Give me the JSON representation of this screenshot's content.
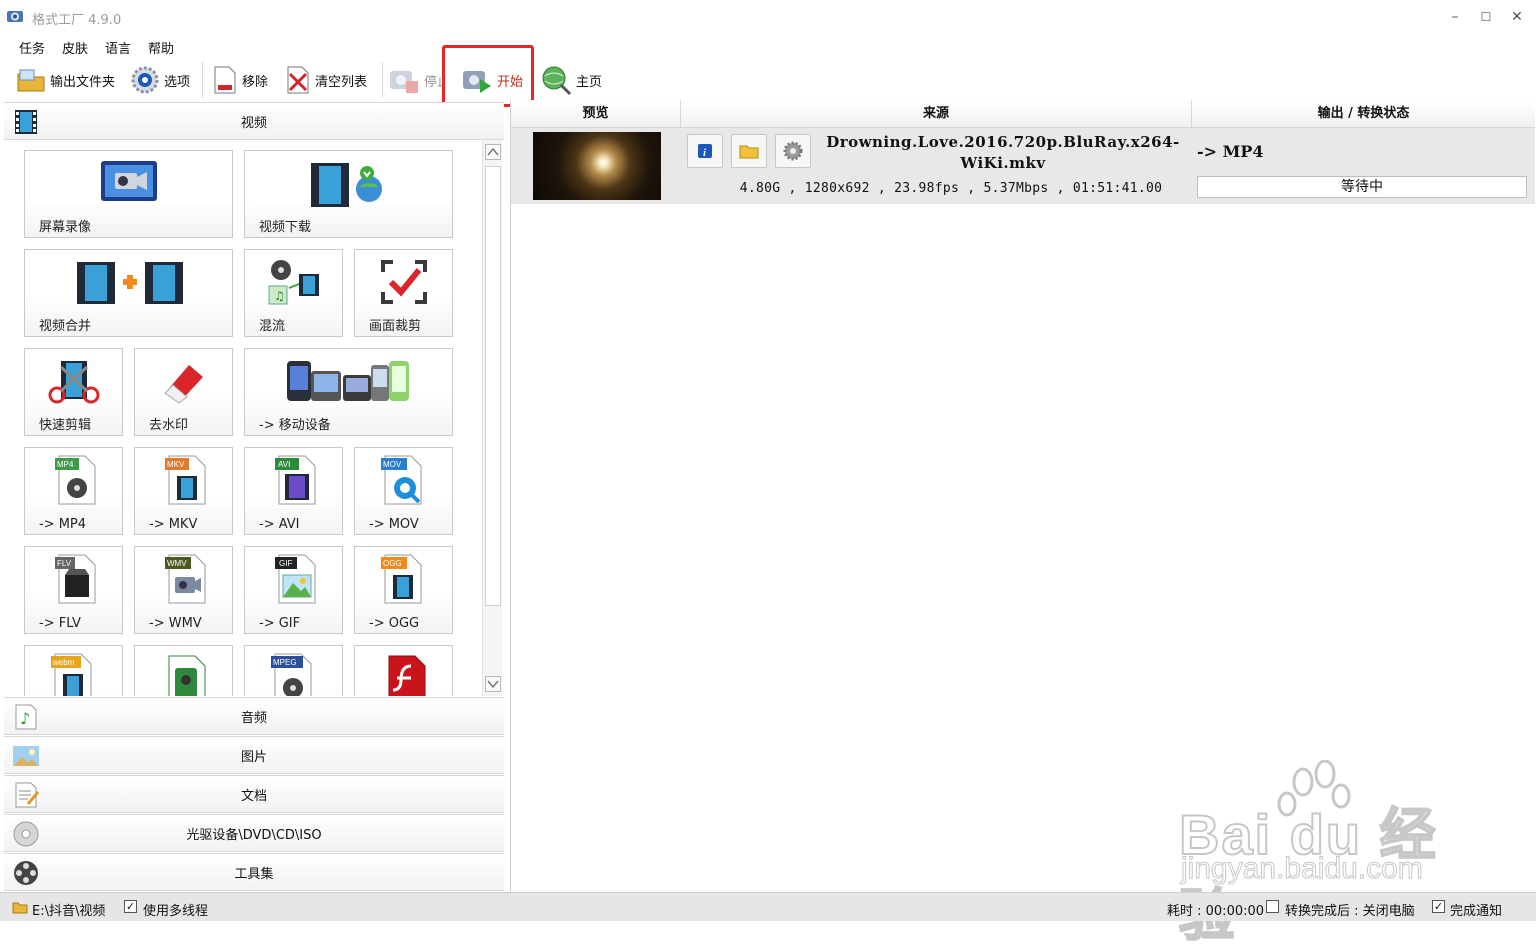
{
  "window": {
    "title": "格式工厂 4.9.0",
    "controls": {
      "minimize": "–",
      "maximize": "☐",
      "close": "✕"
    }
  },
  "menu": [
    "任务",
    "皮肤",
    "语言",
    "帮助"
  ],
  "toolbar": {
    "output_folder": "输出文件夹",
    "options": "选项",
    "remove": "移除",
    "clear_list": "清空列表",
    "stop": "停止",
    "start": "开始",
    "home": "主页"
  },
  "left": {
    "video_header": "视频",
    "tiles": [
      "屏幕录像",
      "视频下载",
      "视频合并",
      "混流",
      "画面裁剪",
      "快速剪辑",
      "去水印",
      "-> 移动设备",
      "-> MP4",
      "-> MKV",
      "-> AVI",
      "-> MOV",
      "-> FLV",
      "-> WMV",
      "-> GIF",
      "-> OGG"
    ],
    "badges": [
      "MP4",
      "MKV",
      "AVI",
      "MOV",
      "FLV",
      "WMV",
      "GIF",
      "OGG",
      "webm",
      "MPEG"
    ],
    "categories": {
      "audio": "音频",
      "image": "图片",
      "document": "文档",
      "disc": "光驱设备\\DVD\\CD\\ISO",
      "tools": "工具集"
    }
  },
  "table": {
    "headers": {
      "preview": "预览",
      "source": "来源",
      "output": "输出 / 转换状态"
    },
    "rows": [
      {
        "file_name": "Drowning.Love.2016.720p.BluRay.x264-WiKi.mkv",
        "info": "4.80G , 1280x692 , 23.98fps , 5.37Mbps , 01:51:41.00",
        "output_format": "-> MP4",
        "status": "等待中"
      }
    ]
  },
  "statusbar": {
    "output_path": "E:\\抖音\\视频",
    "multithread_label": "使用多线程",
    "multithread_checked": true,
    "elapsed_label": "耗时 : 00:00:00",
    "after_done_label": "转换完成后 : 关闭电脑",
    "after_done_checked": false,
    "notify_label": "完成通知",
    "notify_checked": true
  },
  "watermark": {
    "brand": "Bai du 经验",
    "url": "jingyan.baidu.com"
  },
  "colors": {
    "highlight_box": "#e8262a",
    "row_bg": "#e8e8e8",
    "statusbar_bg": "#e6e6e6"
  }
}
